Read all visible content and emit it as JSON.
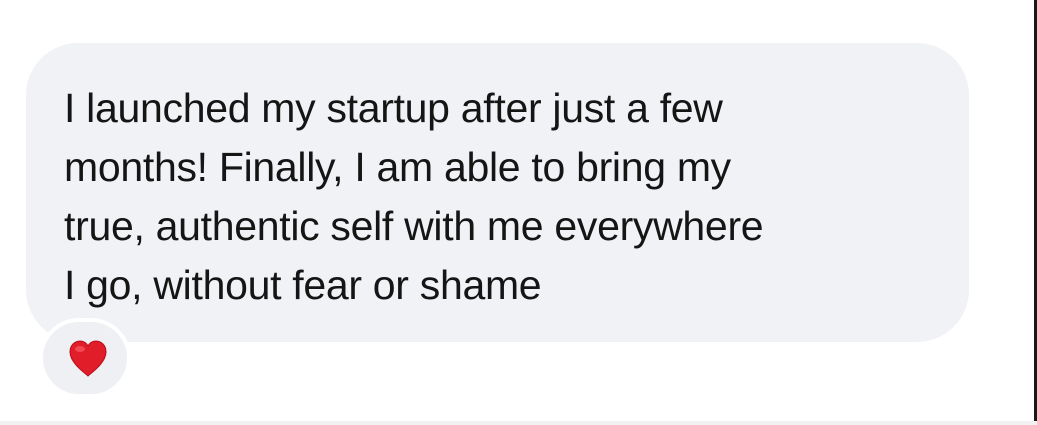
{
  "message": {
    "text": "I launched my startup after just a few\nmonths! Finally, I am able to bring my\ntrue, authentic self with me everywhere\nI go, without fear or shame",
    "bubble_color": "#f1f2f5",
    "text_color": "#151515"
  },
  "reaction": {
    "icon": "heart-icon",
    "color": "#e11d2a"
  }
}
